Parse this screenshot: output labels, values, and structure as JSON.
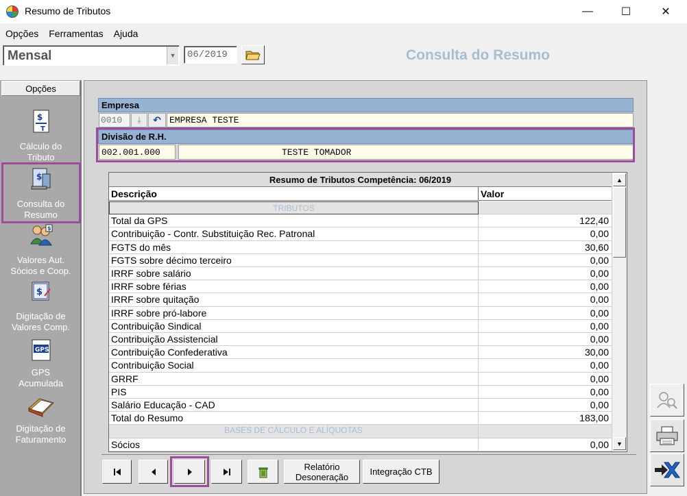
{
  "window": {
    "title": "Resumo de Tributos",
    "controls": {
      "minimize": "—",
      "maximize": "☐",
      "close": "✕"
    }
  },
  "menu": {
    "items": [
      "Opções",
      "Ferramentas",
      "Ajuda"
    ]
  },
  "toolbar": {
    "period": "Mensal",
    "competence": "06/2019",
    "page_title": "Consulta do Resumo"
  },
  "sidebar": {
    "header": "Opções",
    "items": [
      {
        "label_line1": "Cálculo do",
        "label_line2": "Tributo",
        "icon": "calc-tax-icon"
      },
      {
        "label_line1": "Consulta do",
        "label_line2": "Resumo",
        "icon": "summary-query-icon",
        "selected": true
      },
      {
        "label_line1": "Valores Aut.",
        "label_line2": "Sócios e  Coop.",
        "icon": "partners-icon"
      },
      {
        "label_line1": "Digitação de",
        "label_line2": "Valores Comp.",
        "icon": "values-entry-icon"
      },
      {
        "label_line1": "GPS",
        "label_line2": "Acumulada",
        "icon": "gps-icon"
      },
      {
        "label_line1": "Digitação de",
        "label_line2": "Faturamento",
        "icon": "billing-book-icon"
      }
    ]
  },
  "empresa": {
    "header": "Empresa",
    "code": "0010",
    "name": "EMPRESA TESTE"
  },
  "divisao": {
    "header": "Divisão de R.H.",
    "code": "002.001.000",
    "name": "TESTE TOMADOR"
  },
  "table": {
    "title": "Resumo de Tributos Competência: 06/2019",
    "columns": [
      "Descrição",
      "Valor"
    ],
    "section_tributos": "TRIBUTOS",
    "rows": [
      {
        "desc": "Total da GPS",
        "value": "122,40"
      },
      {
        "desc": "Contribuição - Contr. Substituição Rec. Patronal",
        "value": "0,00"
      },
      {
        "desc": "FGTS do mês",
        "value": "30,60"
      },
      {
        "desc": "FGTS sobre décimo terceiro",
        "value": "0,00"
      },
      {
        "desc": "IRRF sobre salário",
        "value": "0,00"
      },
      {
        "desc": "IRRF sobre férias",
        "value": "0,00"
      },
      {
        "desc": "IRRF sobre quitação",
        "value": "0,00"
      },
      {
        "desc": "IRRF sobre pró-labore",
        "value": "0,00"
      },
      {
        "desc": "Contribuição Sindical",
        "value": "0,00"
      },
      {
        "desc": "Contribuição Assistencial",
        "value": "0,00"
      },
      {
        "desc": "Contribuição Confederativa",
        "value": "30,00"
      },
      {
        "desc": "Contribuição Social",
        "value": "0,00"
      },
      {
        "desc": "GRRF",
        "value": "0,00"
      },
      {
        "desc": "PIS",
        "value": "0,00"
      },
      {
        "desc": "Salário Educação - CAD",
        "value": "0,00"
      },
      {
        "desc": "Total do Resumo",
        "value": "183,00"
      }
    ],
    "section_bases": "BASES DE CÁLCULO E ALÍQUOTAS",
    "rows_after": [
      {
        "desc": "Sócios",
        "value": "0,00"
      }
    ]
  },
  "bottom": {
    "first": "first-record",
    "prev": "previous-record",
    "next": "next-record",
    "last": "last-record",
    "report_line1": "Relatório",
    "report_line2": "Desoneração",
    "integration": "Integração CTB"
  },
  "colors": {
    "highlight": "#9b4d9b",
    "section_header": "#97b3d3",
    "title_accent": "#a9bdd1"
  }
}
